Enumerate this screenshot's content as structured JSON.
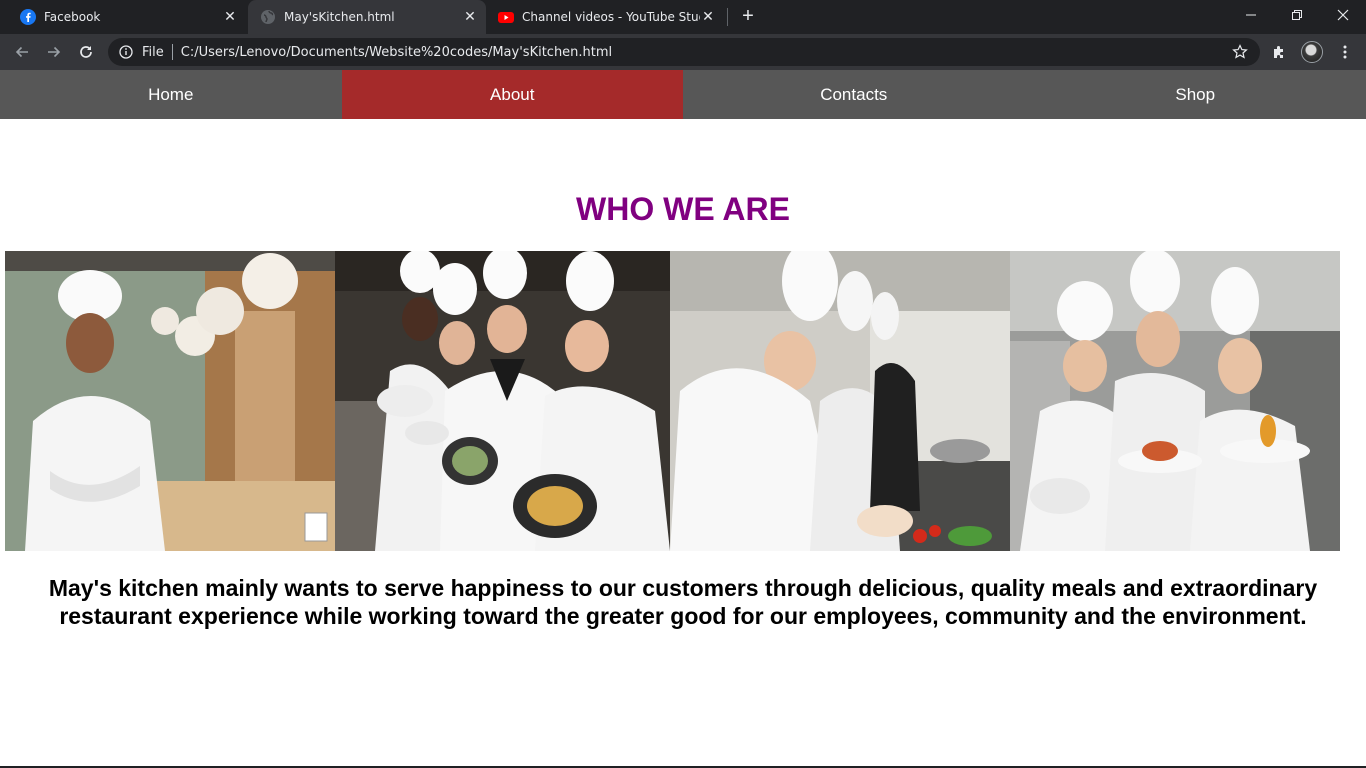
{
  "browser": {
    "tabs": [
      {
        "title": "Facebook",
        "icon": "facebook-icon",
        "active": false
      },
      {
        "title": "May'sKitchen.html",
        "icon": "globe-icon",
        "active": true
      },
      {
        "title": "Channel videos - YouTube Studio",
        "icon": "youtube-icon",
        "active": false
      }
    ],
    "address": {
      "scheme_label": "File",
      "url": "C:/Users/Lenovo/Documents/Website%20codes/May'sKitchen.html"
    }
  },
  "page": {
    "nav": {
      "items": [
        {
          "label": "Home",
          "active": false
        },
        {
          "label": "About",
          "active": true
        },
        {
          "label": "Contacts",
          "active": false
        },
        {
          "label": "Shop",
          "active": false
        }
      ]
    },
    "heading": "WHO WE ARE",
    "photos": [
      {
        "alt": "smiling chef with arms crossed"
      },
      {
        "alt": "four chefs holding plated dishes"
      },
      {
        "alt": "chefs preparing food at counter"
      },
      {
        "alt": "three chefs presenting plates"
      }
    ],
    "mission": "May's kitchen mainly wants to serve happiness to our customers through delicious, quality meals and extraordinary restaurant experience while working toward the greater good for our employees, community and the environment."
  },
  "colors": {
    "nav_bg": "#575757",
    "nav_active": "#a52a2a",
    "heading": "#800080",
    "chrome_dark": "#202124",
    "chrome_toolbar": "#35363a"
  }
}
